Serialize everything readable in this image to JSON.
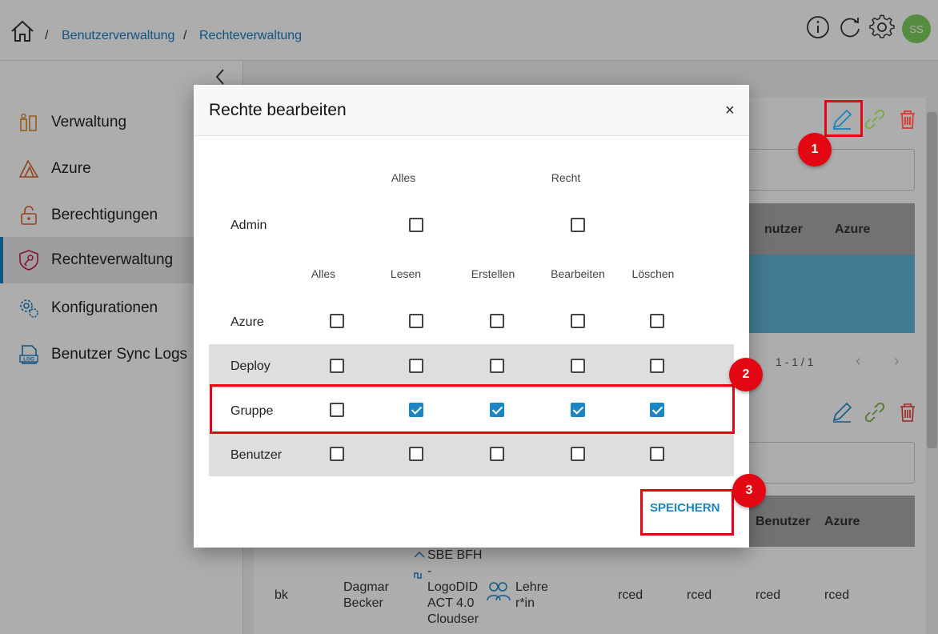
{
  "breadcrumb": {
    "items": [
      "Benutzerverwaltung",
      "Rechteverwaltung"
    ],
    "separator": "/"
  },
  "topbar": {
    "icons": [
      "info-icon",
      "refresh-icon",
      "gear-icon"
    ],
    "avatar_initials": "SS"
  },
  "sidebar": {
    "items": [
      {
        "label": "Verwaltung",
        "icon": "admin-icon"
      },
      {
        "label": "Azure",
        "icon": "azure-icon"
      },
      {
        "label": "Berechtigungen",
        "icon": "lock-icon"
      },
      {
        "label": "Rechteverwaltung",
        "icon": "key-shield-icon",
        "active": true
      },
      {
        "label": "Konfigurationen",
        "icon": "gears-icon"
      },
      {
        "label": "Benutzer Sync Logs",
        "icon": "log-icon"
      }
    ]
  },
  "background": {
    "table1_headers": [
      "nutzer",
      "Azure"
    ],
    "pager": "1 - 1 / 1",
    "table2_headers": [
      "Benutzer",
      "Azure"
    ],
    "row": {
      "c1": "bk",
      "c2": "Dagmar\nBecker",
      "c3": "SBE BFH\n-\nLogoDID\nACT 4.0\nCloudser",
      "c4": "Lehre\nr*in",
      "c5": "rced",
      "c6": "rced",
      "c7": "rced",
      "c8": "rced"
    }
  },
  "dialog": {
    "title": "Rechte bearbeiten",
    "close": "×",
    "admin_section": {
      "columns": [
        "Alles",
        "Recht"
      ],
      "row": {
        "label": "Admin",
        "values": [
          false,
          false
        ]
      }
    },
    "perm_columns": [
      "Alles",
      "Lesen",
      "Erstellen",
      "Bearbeiten",
      "Löschen"
    ],
    "perm_rows": [
      {
        "label": "Azure",
        "values": [
          false,
          false,
          false,
          false,
          false
        ]
      },
      {
        "label": "Deploy",
        "values": [
          false,
          false,
          false,
          false,
          false
        ]
      },
      {
        "label": "Gruppe",
        "values": [
          false,
          true,
          true,
          true,
          true
        ]
      },
      {
        "label": "Benutzer",
        "values": [
          false,
          false,
          false,
          false,
          false
        ]
      }
    ],
    "save_label": "SPEICHERN"
  },
  "annotations": {
    "markers": [
      "1",
      "2",
      "3"
    ],
    "highlight_color": "#e30613"
  },
  "colors": {
    "accent": "#1a86c6",
    "link": "#1a7bbf",
    "selected_row": "#62b4d8",
    "avatar": "#7fcf5e"
  }
}
